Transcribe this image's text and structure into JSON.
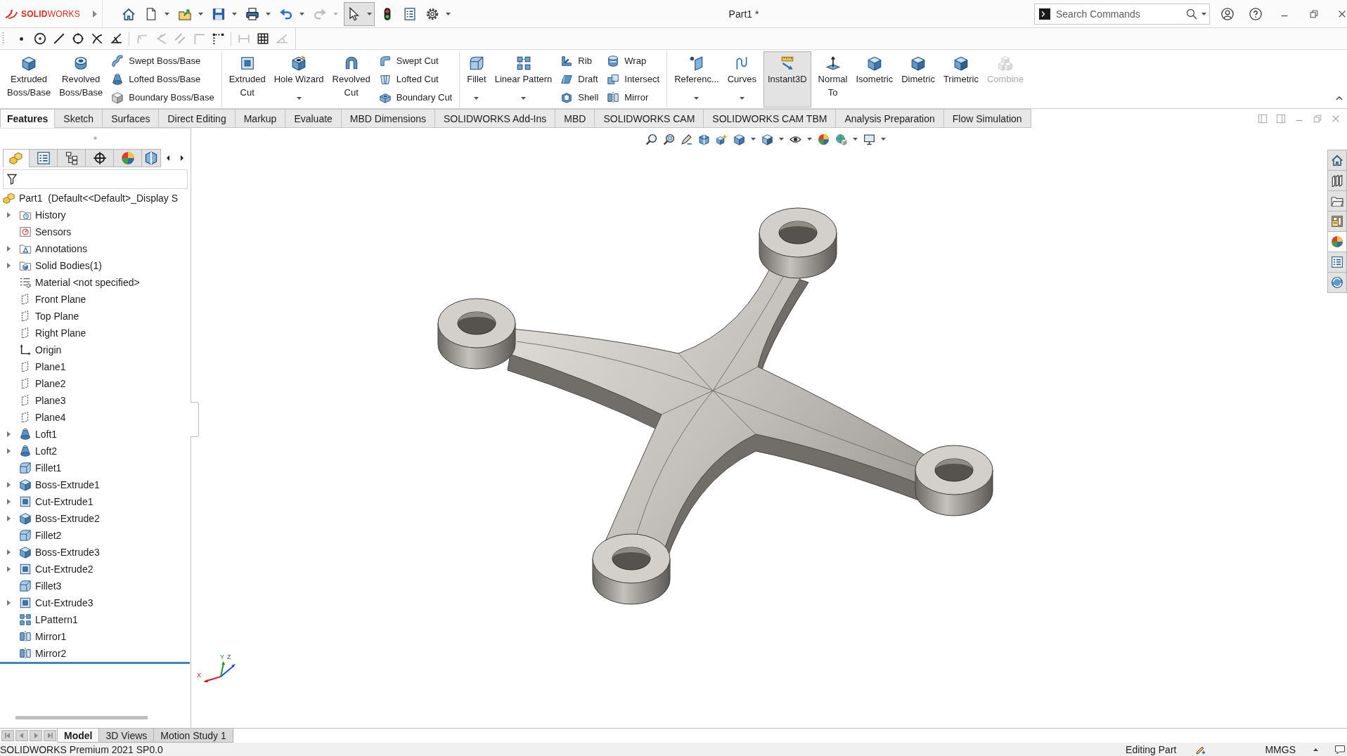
{
  "title_bar": {
    "logo": "**SOLID**WORKS",
    "quick_access": [
      {
        "disabled": false,
        "pressed": false
      },
      {
        "disabled": false,
        "pressed": false
      },
      {
        "disabled": false,
        "pressed": false
      },
      {
        "disabled": false,
        "pressed": false
      },
      {
        "disabled": false,
        "pressed": false
      },
      {
        "disabled": false,
        "pressed": false
      },
      {
        "disabled": true,
        "pressed": false
      },
      {
        "disabled": false,
        "pressed": true
      },
      {
        "disabled": false,
        "pressed": false
      },
      {
        "disabled": false,
        "pressed": false
      },
      {
        "disabled": false,
        "pressed": false
      }
    ],
    "document_title": "Part1 *",
    "search": {
      "placeholder": "Search Commands"
    }
  },
  "sketch_toolbar": [
    {
      "disabled": false
    },
    {
      "disabled": false
    },
    {
      "disabled": false
    },
    {
      "disabled": false
    },
    {
      "disabled": false
    },
    {
      "disabled": false
    },
    {
      "disabled": true
    },
    {
      "disabled": true
    },
    {
      "disabled": true
    },
    {
      "disabled": true
    },
    {
      "disabled": false
    },
    {
      "disabled": true
    },
    {
      "disabled": false
    },
    {
      "disabled": true
    }
  ],
  "command_manager": {
    "groups": [
      {
        "columns": [
          {
            "kind": "large",
            "label": "Extruded Boss/Base",
            "dropdown": false,
            "pressed": false,
            "disabled": false
          },
          {
            "kind": "large",
            "label": "Revolved Boss/Base",
            "dropdown": false,
            "pressed": false,
            "disabled": false
          },
          {
            "kind": "stack",
            "buttons": [
              {
                "label": "Swept Boss/Base"
              },
              {
                "label": "Lofted Boss/Base"
              },
              {
                "label": "Boundary Boss/Base"
              }
            ]
          }
        ]
      },
      {
        "columns": [
          {
            "kind": "large",
            "label": "Extruded Cut",
            "dropdown": false,
            "pressed": false,
            "disabled": false
          },
          {
            "kind": "large",
            "label": "Hole Wizard",
            "dropdown": true,
            "pressed": false,
            "disabled": false
          },
          {
            "kind": "large",
            "label": "Revolved Cut",
            "dropdown": false,
            "pressed": false,
            "disabled": false
          },
          {
            "kind": "stack",
            "buttons": [
              {
                "label": "Swept Cut"
              },
              {
                "label": "Lofted Cut"
              },
              {
                "label": "Boundary Cut"
              }
            ]
          }
        ]
      },
      {
        "columns": [
          {
            "kind": "large",
            "label": "Fillet",
            "dropdown": true,
            "pressed": false,
            "disabled": false
          },
          {
            "kind": "large",
            "label": "Linear Pattern",
            "dropdown": true,
            "pressed": false,
            "disabled": false
          },
          {
            "kind": "stack",
            "buttons": [
              {
                "label": "Rib"
              },
              {
                "label": "Draft"
              },
              {
                "label": "Shell"
              }
            ]
          },
          {
            "kind": "stack",
            "buttons": [
              {
                "label": "Wrap"
              },
              {
                "label": "Intersect"
              },
              {
                "label": "Mirror"
              }
            ]
          }
        ]
      },
      {
        "columns": [
          {
            "kind": "large",
            "label": "Referenc...",
            "dropdown": true,
            "pressed": false,
            "disabled": false
          },
          {
            "kind": "large",
            "label": "Curves",
            "dropdown": true,
            "pressed": false,
            "disabled": false
          },
          {
            "kind": "large",
            "label": "Instant3D",
            "dropdown": false,
            "pressed": true,
            "disabled": false
          },
          {
            "kind": "large",
            "label": "Normal To",
            "dropdown": false,
            "pressed": false,
            "disabled": false
          },
          {
            "kind": "large",
            "label": "Isometric",
            "dropdown": false,
            "pressed": false,
            "disabled": false
          },
          {
            "kind": "large",
            "label": "Dimetric",
            "dropdown": false,
            "pressed": false,
            "disabled": false
          },
          {
            "kind": "large",
            "label": "Trimetric",
            "dropdown": false,
            "pressed": false,
            "disabled": false
          },
          {
            "kind": "large",
            "label": "Combine",
            "dropdown": false,
            "pressed": false,
            "disabled": true
          }
        ]
      }
    ]
  },
  "tabs": [
    {
      "label": "Features",
      "selected": true
    },
    {
      "label": "Sketch",
      "selected": false
    },
    {
      "label": "Surfaces",
      "selected": false
    },
    {
      "label": "Direct Editing",
      "selected": false
    },
    {
      "label": "Markup",
      "selected": false
    },
    {
      "label": "Evaluate",
      "selected": false
    },
    {
      "label": "MBD Dimensions",
      "selected": false
    },
    {
      "label": "SOLIDWORKS Add-Ins",
      "selected": false
    },
    {
      "label": "MBD",
      "selected": false
    },
    {
      "label": "SOLIDWORKS CAM",
      "selected": false
    },
    {
      "label": "SOLIDWORKS CAM TBM",
      "selected": false
    },
    {
      "label": "Analysis Preparation",
      "selected": false
    },
    {
      "label": "Flow Simulation",
      "selected": false
    }
  ],
  "feature_manager": {
    "tabs": [
      {
        "selected": true
      },
      {
        "selected": false
      },
      {
        "selected": false
      },
      {
        "selected": false
      },
      {
        "selected": false
      },
      {
        "selected": false
      }
    ],
    "tree": {
      "label": "Part1  (Default<<Default>_Display S",
      "children": [
        {
          "label": "History",
          "kind": "history",
          "expandable": true
        },
        {
          "label": "Sensors",
          "kind": "sensors",
          "expandable": false
        },
        {
          "label": "Annotations",
          "kind": "annotations",
          "expandable": true
        },
        {
          "label": "Solid Bodies(1)",
          "kind": "bodies",
          "expandable": true
        },
        {
          "label": "Material <not specified>",
          "kind": "material",
          "expandable": false
        },
        {
          "label": "Front Plane",
          "kind": "plane",
          "expandable": false
        },
        {
          "label": "Top Plane",
          "kind": "plane",
          "expandable": false
        },
        {
          "label": "Right Plane",
          "kind": "plane",
          "expandable": false
        },
        {
          "label": "Origin",
          "kind": "origin",
          "expandable": false
        },
        {
          "label": "Plane1",
          "kind": "plane",
          "expandable": false
        },
        {
          "label": "Plane2",
          "kind": "plane",
          "expandable": false
        },
        {
          "label": "Plane3",
          "kind": "plane",
          "expandable": false
        },
        {
          "label": "Plane4",
          "kind": "plane",
          "expandable": false
        },
        {
          "label": "Loft1",
          "kind": "loft",
          "expandable": true
        },
        {
          "label": "Loft2",
          "kind": "loft",
          "expandable": true
        },
        {
          "label": "Fillet1",
          "kind": "fillet",
          "expandable": false
        },
        {
          "label": "Boss-Extrude1",
          "kind": "boss",
          "expandable": true
        },
        {
          "label": "Cut-Extrude1",
          "kind": "cut",
          "expandable": true
        },
        {
          "label": "Boss-Extrude2",
          "kind": "boss",
          "expandable": true
        },
        {
          "label": "Fillet2",
          "kind": "fillet",
          "expandable": false
        },
        {
          "label": "Boss-Extrude3",
          "kind": "boss",
          "expandable": true
        },
        {
          "label": "Cut-Extrude2",
          "kind": "cut",
          "expandable": true
        },
        {
          "label": "Fillet3",
          "kind": "fillet",
          "expandable": false
        },
        {
          "label": "Cut-Extrude3",
          "kind": "cut",
          "expandable": true
        },
        {
          "label": "LPattern1",
          "kind": "pattern",
          "expandable": false
        },
        {
          "label": "Mirror1",
          "kind": "mirror",
          "expandable": false
        },
        {
          "label": "Mirror2",
          "kind": "mirror",
          "expandable": false
        }
      ]
    }
  },
  "viewport": {
    "task_pane": [
      {
        "selected": false
      },
      {
        "selected": false
      },
      {
        "selected": false
      },
      {
        "selected": false
      },
      {
        "selected": true
      },
      {
        "selected": false
      },
      {
        "selected": false
      }
    ],
    "axis_labels": [
      "X",
      "Y",
      "Z"
    ]
  },
  "bottom_tabs": [
    {
      "label": "Model",
      "selected": true
    },
    {
      "label": "3D Views",
      "selected": false
    },
    {
      "label": "Motion Study 1",
      "selected": false
    }
  ],
  "status_bar": {
    "product": "SOLIDWORKS Premium 2021 SP0.0",
    "mode": "Editing Part",
    "units": "MMGS"
  }
}
